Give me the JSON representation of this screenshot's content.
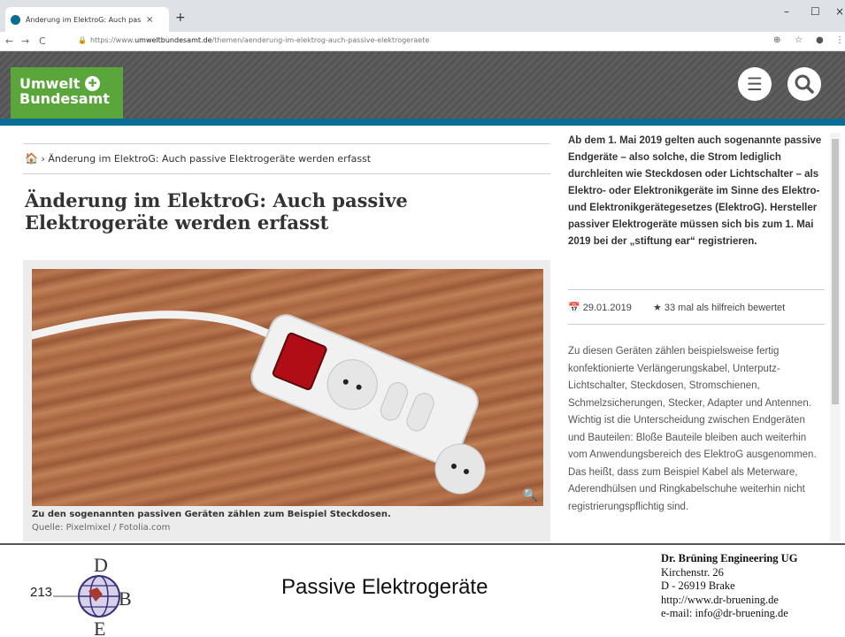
{
  "browser": {
    "tab_title": "Änderung im ElektroG: Auch pas:",
    "tab_close": "×",
    "new_tab": "+",
    "window_controls": {
      "minimize": "–",
      "maximize": "☐",
      "close": "×"
    },
    "nav": {
      "back": "←",
      "forward": "→",
      "reload": "C"
    },
    "url_prefix": "https://www.",
    "url_host": "umweltbundesamt.de",
    "url_path": "/themen/aenderung-im-elektrog-auch-passive-elektrogeraete",
    "address_icons": {
      "zoom": "zoom-icon",
      "bookmark": "star-icon",
      "profile": "profile-icon",
      "menu": "menu-dots-icon"
    }
  },
  "site": {
    "logo_line1": "Umwelt",
    "logo_line2": "Bundesamt",
    "brand_color": "#5ba63a",
    "accent_color": "#0b6c95"
  },
  "breadcrumb": {
    "current": "Änderung im ElektroG: Auch passive Elektrogeräte werden erfasst"
  },
  "page_title": "Änderung im ElektroG: Auch passive Elektrogeräte werden erfasst",
  "figure": {
    "caption": "Zu den sogenannten passiven Geräten zählen zum Beispiel Steckdosen.",
    "source": "Quelle: Pixelmixel / Fotolia.com"
  },
  "aside": {
    "teaser": "Ab dem 1. Mai 2019 gelten auch sogenannte passive Endgeräte – also solche, die Strom lediglich durchleiten wie Steckdosen oder Lichtschalter – als Elektro- oder Elektronikgeräte im Sinne des Elektro- und Elektronikgerätegesetzes (ElektroG). Hersteller passiver Elektrogeräte müssen sich bis zum 1. Mai 2019 bei der „stiftung ear“ registrieren.",
    "date": "29.01.2019",
    "rating": "33 mal als hilfreich bewertet",
    "body": "Zu diesen Geräten zählen beispielsweise fertig konfektionierte Verlängerungskabel, Unterputz-Lichtschalter, Steckdosen, Stromschienen, Schmelzsicherungen, Stecker, Adapter und Antennen. Wichtig ist die Unterscheidung zwischen Endgeräten und Bauteilen: Bloße Bauteile bleiben auch weiterhin vom Anwendungsbereich des ElektroG ausgenommen. Das heißt, dass zum Beispiel Kabel als Meterware, Aderendhülsen und Ringkabelschuhe weiterhin nicht registrierungspflichtig sind."
  },
  "slide": {
    "number": "213",
    "logo_letters": {
      "top": "D",
      "right": "B",
      "bottom": "E"
    },
    "title": "Passive Elektrogeräte",
    "company": {
      "name": "Dr. Brüning Engineering UG",
      "street": "Kirchenstr. 26",
      "city": "D - 26919 Brake",
      "web": "http://www.dr-bruening.de",
      "email": "e-mail: info@dr-bruening.de"
    }
  }
}
